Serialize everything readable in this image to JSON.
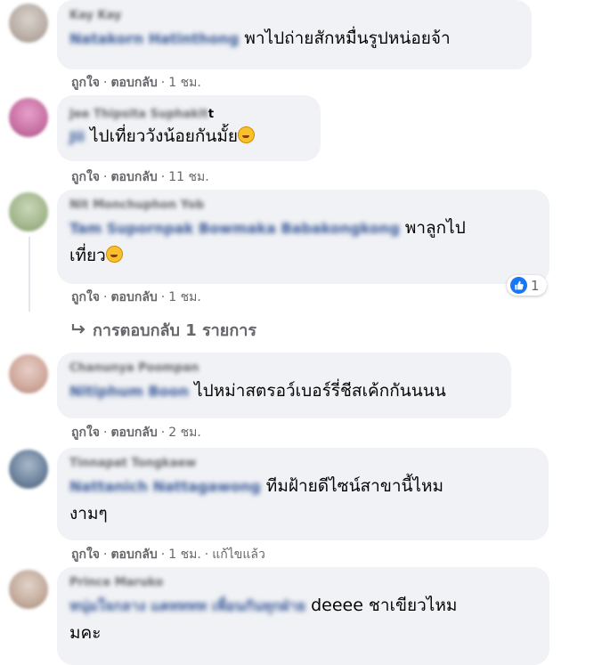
{
  "comments": [
    {
      "author": "Kay Kay",
      "mention": "Natakorn Hatinthong",
      "text": "พาไปถ่ายสักหมื่นรูปหน่อยจ้า",
      "meta": {
        "like": "ถูกใจ",
        "reply": "ตอบกลับ",
        "time": "1 ชม."
      }
    },
    {
      "author_blur": "Jee Thipsita Suphakit",
      "author_visible": "t",
      "mention": "Jii",
      "text": "ไปเที่ยววังน้อยกันมั้ย",
      "meta": {
        "like": "ถูกใจ",
        "reply": "ตอบกลับ",
        "time": "11 ชม."
      }
    },
    {
      "author": "Nit Monchuphon Yob",
      "mention": "Tam Supornpak Bowmaka Babakongkong",
      "text1": "พาลูกไป",
      "text2": "เที่ยว",
      "meta": {
        "like": "ถูกใจ",
        "reply": "ตอบกลับ",
        "time": "1 ชม."
      },
      "reaction_count": "1",
      "replies_label": "การตอบกลับ 1 รายการ"
    },
    {
      "author": "Chanunya Poompan",
      "mention": "Nitiphum Boon",
      "text": "ไปหม่าสตรอว์เบอร์รี่ชีสเค้กกันนนน",
      "meta": {
        "like": "ถูกใจ",
        "reply": "ตอบกลับ",
        "time": "2 ชม."
      }
    },
    {
      "author": "Tinnapat Tongkaew",
      "mention": "Nattanich Nattagawong",
      "text1": "ทีมฝ้ายดีไซน์สาขานี้ไหม",
      "text2": "งามๆ",
      "meta": {
        "like": "ถูกใจ",
        "reply": "ตอบกลับ",
        "time": "1 ชม.",
        "edited": "แก้ไขแล้ว"
      }
    },
    {
      "author": "Prince Maruko",
      "mention": "หนุ่มใจกลาง แคทททท เพื่อนกันทุกฝ่าย",
      "text1": "deeee ชาเขียวไหม",
      "text2": "มคะ"
    }
  ],
  "icons": {
    "reply_arrow": "reply-arrow-icon",
    "like": "like-thumb-icon",
    "emoji": "rofl-emoji-icon"
  },
  "colors": {
    "bubble": "#f0f2f5",
    "meta": "#65676b",
    "like_blue": "#1877f2"
  }
}
